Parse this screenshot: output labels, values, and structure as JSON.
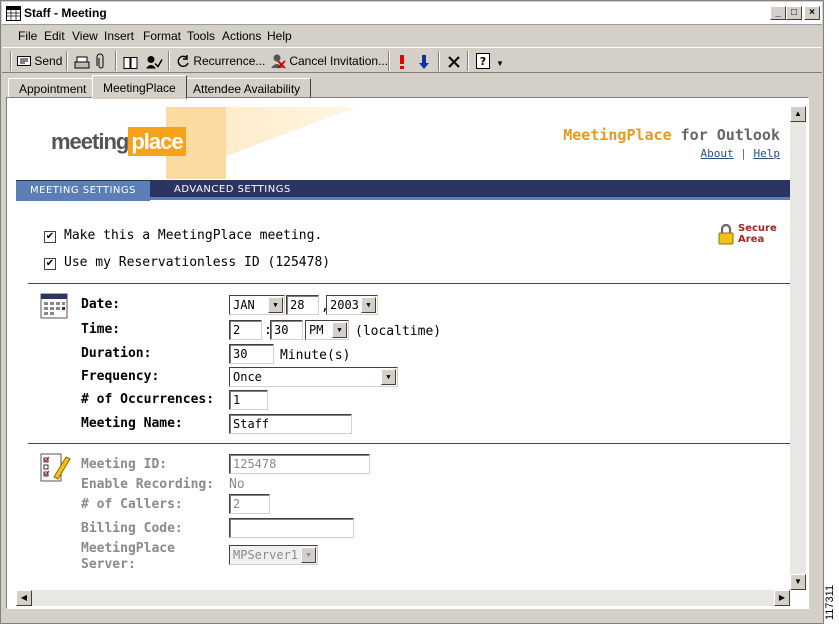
{
  "window": {
    "title": "Staff - Meeting"
  },
  "menu": [
    "File",
    "Edit",
    "View",
    "Insert",
    "Format",
    "Tools",
    "Actions",
    "Help"
  ],
  "toolbar": {
    "send": "Send",
    "recurrence": "Recurrence...",
    "cancel_invitation": "Cancel Invitation..."
  },
  "tabs": [
    "Appointment",
    "MeetingPlace",
    "Attendee Availability"
  ],
  "active_tab": "MeetingPlace",
  "page": {
    "logo": {
      "part1": "meeting",
      "part2": "place"
    },
    "product": {
      "name": "MeetingPlace",
      "suffix": " for Outlook"
    },
    "links": {
      "about": "About",
      "separator": "|",
      "help": "Help"
    },
    "nav": {
      "settings": "MEETING SETTINGS",
      "advanced": "ADVANCED SETTINGS"
    },
    "checkboxes": [
      {
        "label": "Make this a MeetingPlace meeting.",
        "checked": true
      },
      {
        "label": "Use my Reservationless ID (125478)",
        "checked": true
      }
    ],
    "secure": {
      "line1": "Secure",
      "line2": "Area"
    },
    "schedule": {
      "date_label": "Date:",
      "month": "JAN",
      "day": "28",
      "comma": ",",
      "year": "2003",
      "time_label": "Time:",
      "hour": "2",
      "colon": ":",
      "minute": "30",
      "ampm": "PM",
      "tz": "(localtime)",
      "duration_label": "Duration:",
      "duration": "30",
      "duration_unit": "Minute(s)",
      "frequency_label": "Frequency:",
      "frequency": "Once",
      "occurrences_label": "# of Occurrences:",
      "occurrences": "1",
      "name_label": "Meeting Name:",
      "name": "Staff"
    },
    "details": {
      "id_label": "Meeting ID:",
      "id": "125478",
      "recording_label": "Enable Recording:",
      "recording": "No",
      "callers_label": "# of Callers:",
      "callers": "2",
      "billing_label": "Billing Code:",
      "billing": "",
      "server_label_1": "MeetingPlace",
      "server_label_2": "Server:",
      "server": "MPServer1"
    }
  },
  "figure_number": "117311"
}
